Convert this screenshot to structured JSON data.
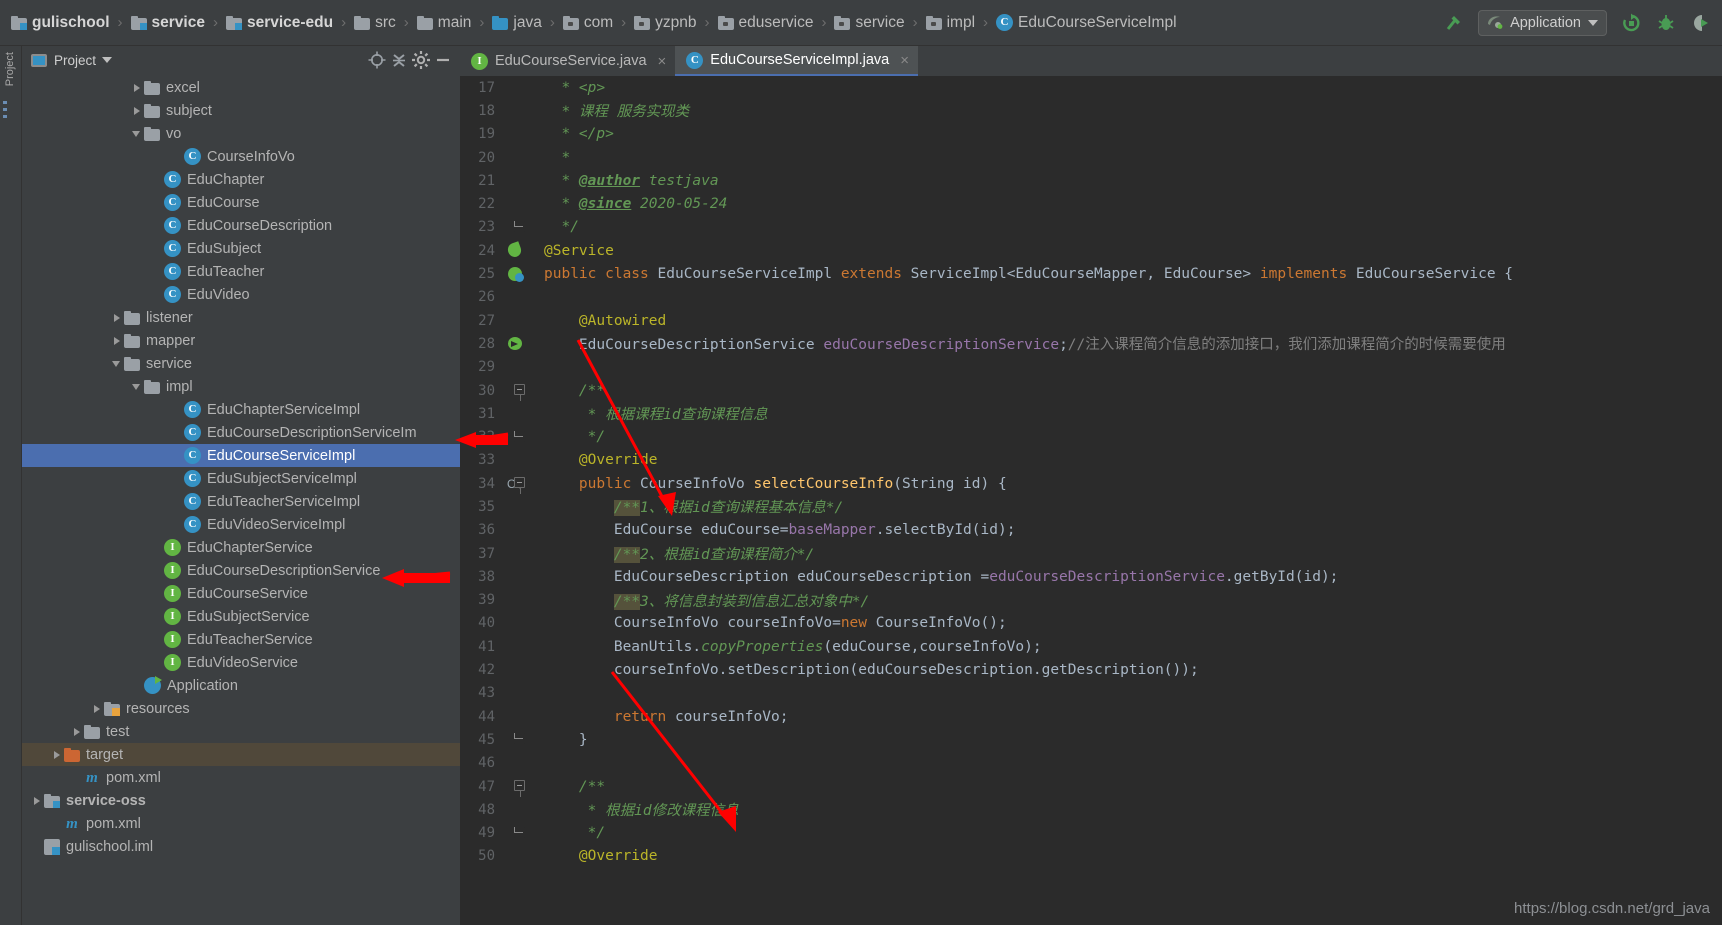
{
  "window": {
    "theme_bg": "#3c3f41",
    "editor_bg": "#2b2b2b",
    "accent": "#4b6eaf"
  },
  "navbar": {
    "breadcrumbs": [
      {
        "label": "gulischool",
        "icon": "module-icon",
        "bold": true
      },
      {
        "label": "service",
        "icon": "module-icon",
        "bold": true
      },
      {
        "label": "service-edu",
        "icon": "module-icon",
        "bold": true
      },
      {
        "label": "src",
        "icon": "folder-icon",
        "bold": false
      },
      {
        "label": "main",
        "icon": "folder-icon",
        "bold": false
      },
      {
        "label": "java",
        "icon": "source-folder-icon",
        "bold": false
      },
      {
        "label": "com",
        "icon": "package-folder-icon",
        "bold": false
      },
      {
        "label": "yzpnb",
        "icon": "package-folder-icon",
        "bold": false
      },
      {
        "label": "eduservice",
        "icon": "package-folder-icon",
        "bold": false
      },
      {
        "label": "service",
        "icon": "package-folder-icon",
        "bold": false
      },
      {
        "label": "impl",
        "icon": "package-folder-icon",
        "bold": false
      },
      {
        "label": "EduCourseServiceImpl",
        "icon": "class-icon",
        "bold": false
      }
    ],
    "separator": "›",
    "toolbar": {
      "build_icon": "hammer-icon",
      "run_config_label": "Application",
      "run_config_icon": "spring-boot-icon",
      "run_icon": "run-icon",
      "debug_icon": "debug-icon",
      "run_with_coverage_icon": "run-with-coverage-icon"
    }
  },
  "left_strip": {
    "tabs": [
      "Project"
    ]
  },
  "project_panel": {
    "title": "Project",
    "buttons": [
      "locate-icon",
      "collapse-all-icon",
      "settings-gear-icon",
      "hide-icon"
    ],
    "tree": [
      {
        "indent": 5,
        "arrow": "closed",
        "icon": "folder-icon",
        "label": "excel"
      },
      {
        "indent": 5,
        "arrow": "closed",
        "icon": "folder-icon",
        "label": "subject"
      },
      {
        "indent": 5,
        "arrow": "open",
        "icon": "folder-icon",
        "label": "vo"
      },
      {
        "indent": 7,
        "arrow": "none",
        "icon": "class-icon",
        "label": "CourseInfoVo"
      },
      {
        "indent": 6,
        "arrow": "none",
        "icon": "class-icon",
        "label": "EduChapter"
      },
      {
        "indent": 6,
        "arrow": "none",
        "icon": "class-icon",
        "label": "EduCourse"
      },
      {
        "indent": 6,
        "arrow": "none",
        "icon": "class-icon",
        "label": "EduCourseDescription"
      },
      {
        "indent": 6,
        "arrow": "none",
        "icon": "class-icon",
        "label": "EduSubject"
      },
      {
        "indent": 6,
        "arrow": "none",
        "icon": "class-icon",
        "label": "EduTeacher"
      },
      {
        "indent": 6,
        "arrow": "none",
        "icon": "class-icon",
        "label": "EduVideo"
      },
      {
        "indent": 4,
        "arrow": "closed",
        "icon": "folder-icon",
        "label": "listener"
      },
      {
        "indent": 4,
        "arrow": "closed",
        "icon": "folder-icon",
        "label": "mapper"
      },
      {
        "indent": 4,
        "arrow": "open",
        "icon": "folder-icon",
        "label": "service"
      },
      {
        "indent": 5,
        "arrow": "open",
        "icon": "folder-icon",
        "label": "impl"
      },
      {
        "indent": 7,
        "arrow": "none",
        "icon": "class-icon",
        "label": "EduChapterServiceImpl"
      },
      {
        "indent": 7,
        "arrow": "none",
        "icon": "class-icon",
        "label": "EduCourseDescriptionServiceIm"
      },
      {
        "indent": 7,
        "arrow": "none",
        "icon": "class-icon",
        "label": "EduCourseServiceImpl",
        "selected": true
      },
      {
        "indent": 7,
        "arrow": "none",
        "icon": "class-icon",
        "label": "EduSubjectServiceImpl"
      },
      {
        "indent": 7,
        "arrow": "none",
        "icon": "class-icon",
        "label": "EduTeacherServiceImpl"
      },
      {
        "indent": 7,
        "arrow": "none",
        "icon": "class-icon",
        "label": "EduVideoServiceImpl"
      },
      {
        "indent": 6,
        "arrow": "none",
        "icon": "interface-icon",
        "label": "EduChapterService"
      },
      {
        "indent": 6,
        "arrow": "none",
        "icon": "interface-icon",
        "label": "EduCourseDescriptionService"
      },
      {
        "indent": 6,
        "arrow": "none",
        "icon": "interface-icon",
        "label": "EduCourseService"
      },
      {
        "indent": 6,
        "arrow": "none",
        "icon": "interface-icon",
        "label": "EduSubjectService"
      },
      {
        "indent": 6,
        "arrow": "none",
        "icon": "interface-icon",
        "label": "EduTeacherService"
      },
      {
        "indent": 6,
        "arrow": "none",
        "icon": "interface-icon",
        "label": "EduVideoService"
      },
      {
        "indent": 5,
        "arrow": "none",
        "icon": "spring-app-icon",
        "label": "Application"
      },
      {
        "indent": 3,
        "arrow": "closed",
        "icon": "resources-folder-icon",
        "label": "resources"
      },
      {
        "indent": 2,
        "arrow": "closed",
        "icon": "folder-icon",
        "label": "test"
      },
      {
        "indent": 1,
        "arrow": "closed",
        "icon": "target-folder-icon",
        "label": "target",
        "highlight": true
      },
      {
        "indent": 2,
        "arrow": "none",
        "icon": "maven-xml-icon",
        "label": "pom.xml"
      },
      {
        "indent": 0,
        "arrow": "closed",
        "icon": "module-icon",
        "label": "service-oss",
        "bold": true
      },
      {
        "indent": 1,
        "arrow": "none",
        "icon": "maven-xml-icon",
        "label": "pom.xml"
      },
      {
        "indent": 0,
        "arrow": "none",
        "icon": "iml-file-icon",
        "label": "gulischool.iml"
      }
    ]
  },
  "editor": {
    "tabs": [
      {
        "label": "EduCourseService.java",
        "icon": "interface-icon",
        "active": false,
        "closable": true
      },
      {
        "label": "EduCourseServiceImpl.java",
        "icon": "class-icon",
        "active": true,
        "closable": true
      }
    ],
    "first_line": 17,
    "lines": [
      {
        "n": 17,
        "gutter": "",
        "fold": "",
        "tokens": [
          {
            "t": "  * <p>",
            "c": "cm"
          }
        ]
      },
      {
        "n": 18,
        "gutter": "",
        "fold": "",
        "tokens": [
          {
            "t": "  * 课程 服务实现类",
            "c": "cm"
          }
        ]
      },
      {
        "n": 19,
        "gutter": "",
        "fold": "",
        "tokens": [
          {
            "t": "  * </p>",
            "c": "cm"
          }
        ]
      },
      {
        "n": 20,
        "gutter": "",
        "fold": "",
        "tokens": [
          {
            "t": "  *",
            "c": "cm"
          }
        ]
      },
      {
        "n": 21,
        "gutter": "",
        "fold": "",
        "tokens": [
          {
            "t": "  * ",
            "c": "cm"
          },
          {
            "t": "@author",
            "c": "cmu"
          },
          {
            "t": " testjava",
            "c": "cm"
          }
        ]
      },
      {
        "n": 22,
        "gutter": "",
        "fold": "",
        "tokens": [
          {
            "t": "  * ",
            "c": "cm"
          },
          {
            "t": "@since",
            "c": "cmu"
          },
          {
            "t": " 2020-05-24",
            "c": "cm"
          }
        ]
      },
      {
        "n": 23,
        "gutter": "",
        "fold": "end",
        "tokens": [
          {
            "t": "  */",
            "c": "cm"
          }
        ]
      },
      {
        "n": 24,
        "gutter": "bean-leaf-icon",
        "fold": "",
        "tokens": [
          {
            "t": "@Service",
            "c": "ann"
          }
        ]
      },
      {
        "n": 25,
        "gutter": "spring-class-icon",
        "fold": "",
        "tokens": [
          {
            "t": "public ",
            "c": "kw"
          },
          {
            "t": "class ",
            "c": "kw"
          },
          {
            "t": "EduCourseServiceImpl ",
            "c": "typ"
          },
          {
            "t": "extends ",
            "c": "kw"
          },
          {
            "t": "ServiceImpl<EduCourseMapper, EduCourse> ",
            "c": "typ"
          },
          {
            "t": "implements ",
            "c": "kw"
          },
          {
            "t": "EduCourseService {",
            "c": "typ"
          }
        ]
      },
      {
        "n": 26,
        "gutter": "",
        "fold": "",
        "tokens": [
          {
            "t": "",
            "c": ""
          }
        ]
      },
      {
        "n": 27,
        "gutter": "",
        "fold": "",
        "tokens": [
          {
            "t": "    @Autowired",
            "c": "ann"
          }
        ]
      },
      {
        "n": 28,
        "gutter": "autowire-icon",
        "fold": "",
        "tokens": [
          {
            "t": "    EduCourseDescriptionService ",
            "c": "typ"
          },
          {
            "t": "eduCourseDescriptionService",
            "c": "fld"
          },
          {
            "t": ";",
            "c": "typ"
          },
          {
            "t": "//注入课程简介信息的添加接口，我们添加课程简介的时候需要使用",
            "c": "gc"
          }
        ]
      },
      {
        "n": 29,
        "gutter": "",
        "fold": "",
        "tokens": [
          {
            "t": "",
            "c": ""
          }
        ]
      },
      {
        "n": 30,
        "gutter": "",
        "fold": "start",
        "tokens": [
          {
            "t": "    /**",
            "c": "cm"
          }
        ]
      },
      {
        "n": 31,
        "gutter": "",
        "fold": "",
        "tokens": [
          {
            "t": "     * 根据课程id查询课程信息",
            "c": "cm"
          }
        ]
      },
      {
        "n": 32,
        "gutter": "",
        "fold": "end",
        "tokens": [
          {
            "t": "     */",
            "c": "cm"
          }
        ]
      },
      {
        "n": 33,
        "gutter": "",
        "fold": "",
        "tokens": [
          {
            "t": "    @Override",
            "c": "ann"
          }
        ]
      },
      {
        "n": 34,
        "gutter": "override-icon",
        "fold": "start",
        "tokens": [
          {
            "t": "    public ",
            "c": "kw"
          },
          {
            "t": "CourseInfoVo ",
            "c": "typ"
          },
          {
            "t": "selectCourseInfo",
            "c": "mtd"
          },
          {
            "t": "(String id) {",
            "c": "typ"
          }
        ]
      },
      {
        "n": 35,
        "gutter": "",
        "fold": "",
        "tokens": [
          {
            "t": "        ",
            "c": ""
          },
          {
            "t": "/**",
            "c": "cm hlblk"
          },
          {
            "t": "1、根据id查询课程基本信息*/",
            "c": "cm"
          }
        ]
      },
      {
        "n": 36,
        "gutter": "",
        "fold": "",
        "tokens": [
          {
            "t": "        EduCourse eduCourse=",
            "c": "typ"
          },
          {
            "t": "baseMapper",
            "c": "fld"
          },
          {
            "t": ".selectById(id);",
            "c": "typ"
          }
        ]
      },
      {
        "n": 37,
        "gutter": "",
        "fold": "",
        "tokens": [
          {
            "t": "        ",
            "c": ""
          },
          {
            "t": "/**",
            "c": "cm hlblk"
          },
          {
            "t": "2、根据id查询课程简介*/",
            "c": "cm"
          }
        ]
      },
      {
        "n": 38,
        "gutter": "",
        "fold": "",
        "tokens": [
          {
            "t": "        EduCourseDescription eduCourseDescription =",
            "c": "typ"
          },
          {
            "t": "eduCourseDescriptionService",
            "c": "fld"
          },
          {
            "t": ".getById(id);",
            "c": "typ"
          }
        ]
      },
      {
        "n": 39,
        "gutter": "",
        "fold": "",
        "tokens": [
          {
            "t": "        ",
            "c": ""
          },
          {
            "t": "/**",
            "c": "cm hlblk"
          },
          {
            "t": "3、将信息封装到信息汇总对象中*/",
            "c": "cm"
          }
        ]
      },
      {
        "n": 40,
        "gutter": "",
        "fold": "",
        "tokens": [
          {
            "t": "        CourseInfoVo courseInfoVo=",
            "c": "typ"
          },
          {
            "t": "new ",
            "c": "kw"
          },
          {
            "t": "CourseInfoVo();",
            "c": "typ"
          }
        ]
      },
      {
        "n": 41,
        "gutter": "",
        "fold": "",
        "tokens": [
          {
            "t": "        BeanUtils.",
            "c": "typ"
          },
          {
            "t": "copyProperties",
            "c": "cm"
          },
          {
            "t": "(eduCourse,courseInfoVo);",
            "c": "typ"
          }
        ]
      },
      {
        "n": 42,
        "gutter": "",
        "fold": "",
        "tokens": [
          {
            "t": "        courseInfoVo.setDescription(eduCourseDescription.getDescription());",
            "c": "typ"
          }
        ]
      },
      {
        "n": 43,
        "gutter": "",
        "fold": "",
        "tokens": [
          {
            "t": "",
            "c": ""
          }
        ]
      },
      {
        "n": 44,
        "gutter": "",
        "fold": "",
        "tokens": [
          {
            "t": "        return ",
            "c": "kw"
          },
          {
            "t": "courseInfoVo;",
            "c": "typ"
          }
        ]
      },
      {
        "n": 45,
        "gutter": "",
        "fold": "end",
        "tokens": [
          {
            "t": "    }",
            "c": "typ"
          }
        ]
      },
      {
        "n": 46,
        "gutter": "",
        "fold": "",
        "tokens": [
          {
            "t": "",
            "c": ""
          }
        ]
      },
      {
        "n": 47,
        "gutter": "",
        "fold": "start",
        "tokens": [
          {
            "t": "    /**",
            "c": "cm"
          }
        ]
      },
      {
        "n": 48,
        "gutter": "",
        "fold": "",
        "tokens": [
          {
            "t": "     * 根据id修改课程信息",
            "c": "cm"
          }
        ]
      },
      {
        "n": 49,
        "gutter": "",
        "fold": "end",
        "tokens": [
          {
            "t": "     */",
            "c": "cm"
          }
        ]
      },
      {
        "n": 50,
        "gutter": "",
        "fold": "",
        "tokens": [
          {
            "t": "    @Override",
            "c": "ann"
          }
        ]
      }
    ]
  },
  "watermark": "https://blog.csdn.net/grd_java",
  "annotations": {
    "arrow_color": "#ff0000",
    "count": 4
  }
}
